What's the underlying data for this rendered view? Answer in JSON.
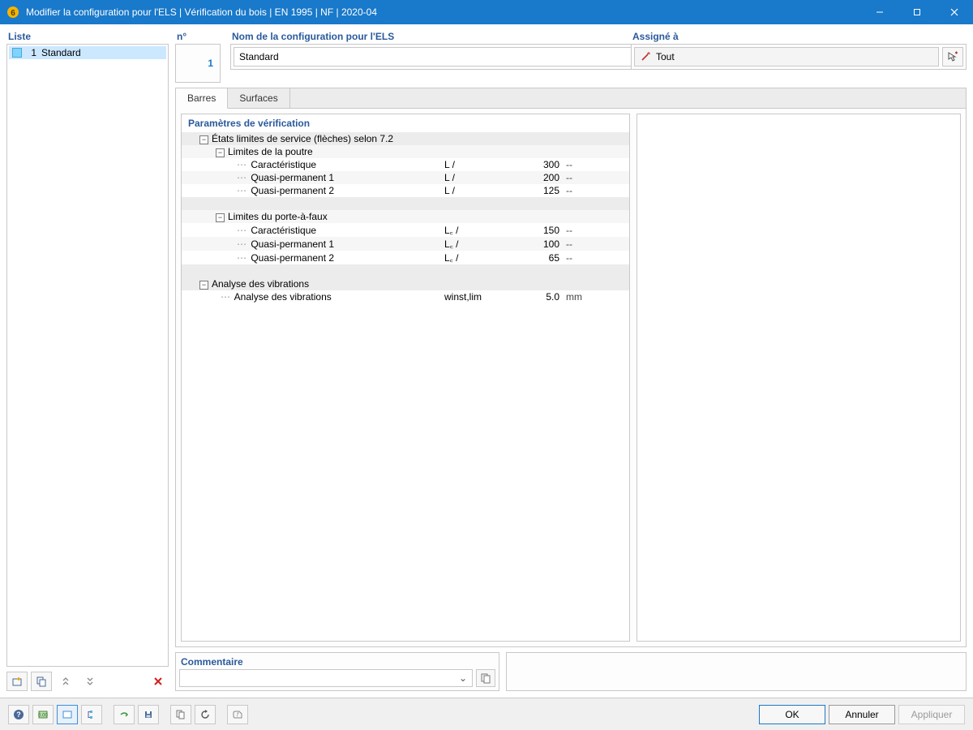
{
  "window": {
    "title": "Modifier la configuration pour l'ELS | Vérification du bois | EN 1995 | NF | 2020-04"
  },
  "leftPanel": {
    "header": "Liste",
    "items": [
      {
        "num": "1",
        "label": "Standard"
      }
    ]
  },
  "topFields": {
    "numLabel": "n°",
    "numValue": "1",
    "nameLabel": "Nom de la configuration pour l'ELS",
    "nameValue": "Standard"
  },
  "assigned": {
    "label": "Assigné à",
    "value": "Tout"
  },
  "tabs": {
    "barres": "Barres",
    "surfaces": "Surfaces"
  },
  "grid": {
    "header": "Paramètres de vérification",
    "section1": "États limites de service (flèches) selon 7.2",
    "sub1": "Limites de la poutre",
    "sub1_rows": [
      {
        "label": "Caractéristique",
        "sym": "L /",
        "val": "300",
        "unit": "--"
      },
      {
        "label": "Quasi-permanent 1",
        "sym": "L /",
        "val": "200",
        "unit": "--"
      },
      {
        "label": "Quasi-permanent 2",
        "sym": "L /",
        "val": "125",
        "unit": "--"
      }
    ],
    "sub2": "Limites du porte-à-faux",
    "sub2_rows": [
      {
        "label": "Caractéristique",
        "sym": "L꜀ /",
        "val": "150",
        "unit": "--"
      },
      {
        "label": "Quasi-permanent 1",
        "sym": "L꜀ /",
        "val": "100",
        "unit": "--"
      },
      {
        "label": "Quasi-permanent 2",
        "sym": "L꜀ /",
        "val": "65",
        "unit": "--"
      }
    ],
    "section2": "Analyse des vibrations",
    "vib_row": {
      "label": "Analyse des vibrations",
      "sym": "winst,lim",
      "val": "5.0",
      "unit": "mm"
    }
  },
  "comment": {
    "label": "Commentaire",
    "value": ""
  },
  "buttons": {
    "ok": "OK",
    "cancel": "Annuler",
    "apply": "Appliquer"
  }
}
